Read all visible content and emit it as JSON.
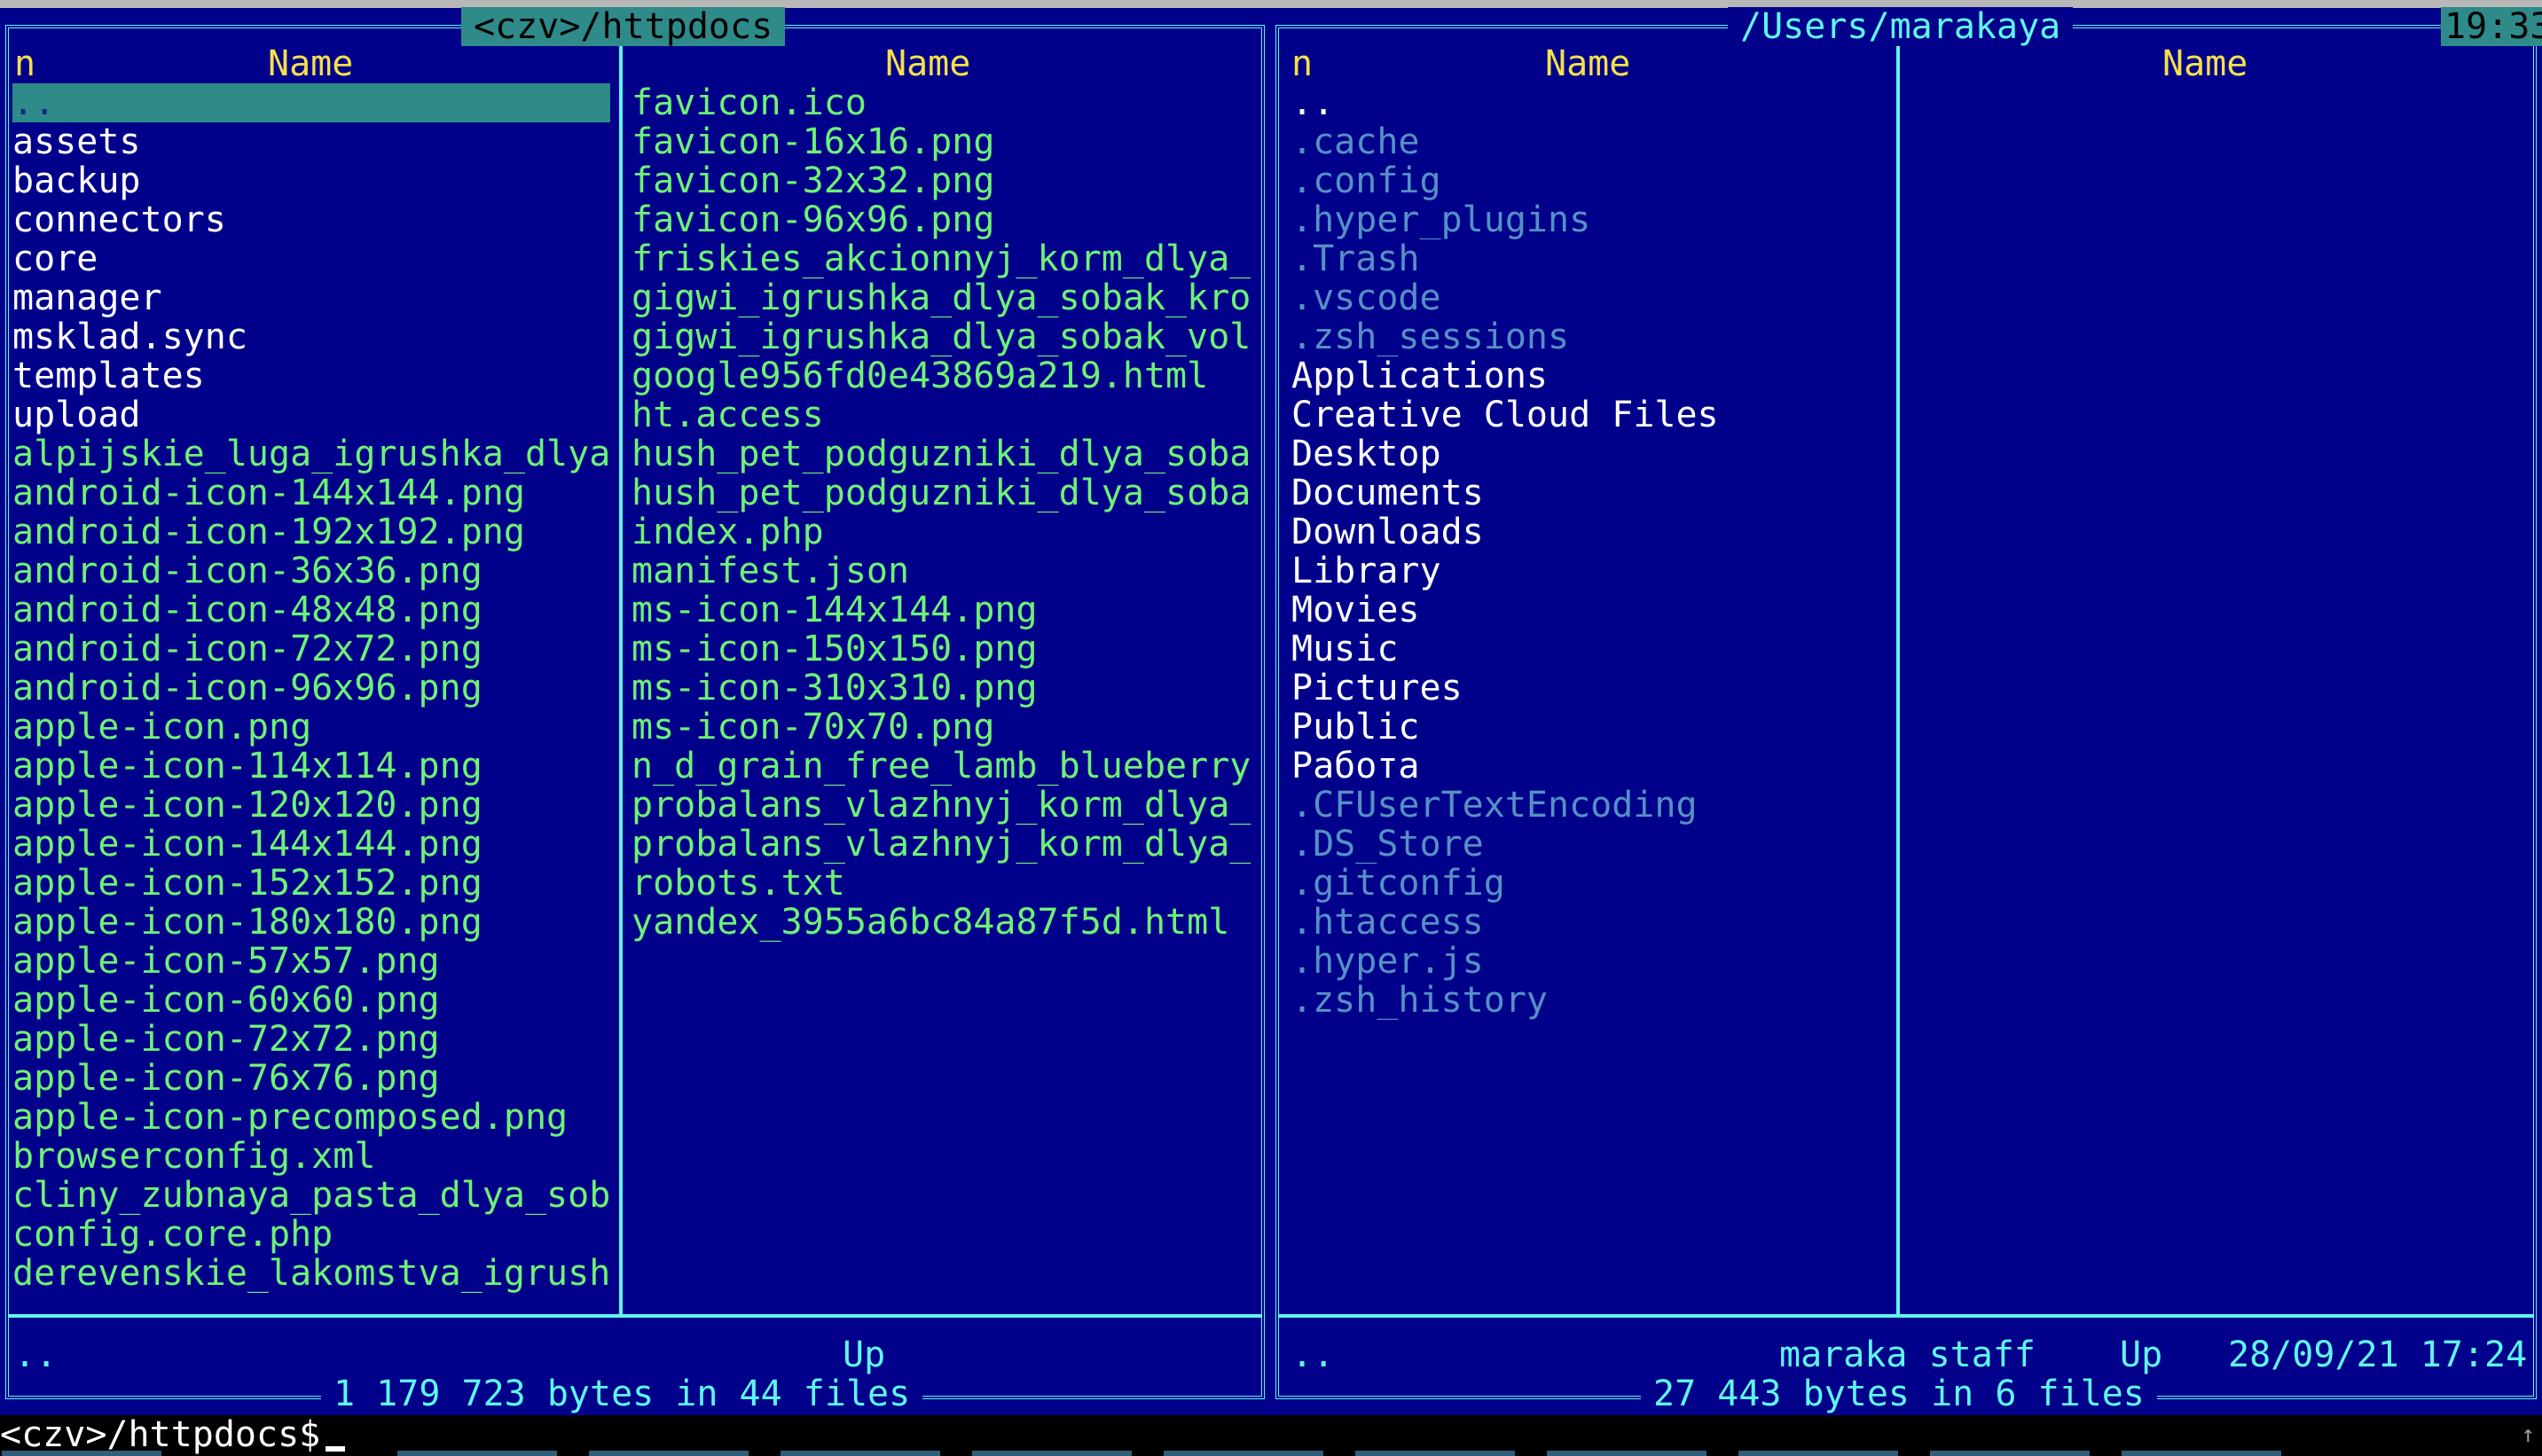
{
  "left_panel": {
    "title": "<czv>/httpdocs",
    "header_n": "n",
    "header_name_1": "Name",
    "header_name_2": "Name",
    "column1": [
      {
        "name": "..",
        "kind": "dir",
        "selected": true
      },
      {
        "name": "assets",
        "kind": "dir"
      },
      {
        "name": "backup",
        "kind": "dir"
      },
      {
        "name": "connectors",
        "kind": "dir"
      },
      {
        "name": "core",
        "kind": "dir"
      },
      {
        "name": "manager",
        "kind": "dir"
      },
      {
        "name": "msklad.sync",
        "kind": "dir"
      },
      {
        "name": "templates",
        "kind": "dir"
      },
      {
        "name": "upload",
        "kind": "dir"
      },
      {
        "name": "alpijskie_luga_igrushka_dlya",
        "kind": "file",
        "truncated": true
      },
      {
        "name": "android-icon-144x144.png",
        "kind": "file"
      },
      {
        "name": "android-icon-192x192.png",
        "kind": "file"
      },
      {
        "name": "android-icon-36x36.png",
        "kind": "file"
      },
      {
        "name": "android-icon-48x48.png",
        "kind": "file"
      },
      {
        "name": "android-icon-72x72.png",
        "kind": "file"
      },
      {
        "name": "android-icon-96x96.png",
        "kind": "file"
      },
      {
        "name": "apple-icon.png",
        "kind": "file"
      },
      {
        "name": "apple-icon-114x114.png",
        "kind": "file"
      },
      {
        "name": "apple-icon-120x120.png",
        "kind": "file"
      },
      {
        "name": "apple-icon-144x144.png",
        "kind": "file"
      },
      {
        "name": "apple-icon-152x152.png",
        "kind": "file"
      },
      {
        "name": "apple-icon-180x180.png",
        "kind": "file"
      },
      {
        "name": "apple-icon-57x57.png",
        "kind": "file"
      },
      {
        "name": "apple-icon-60x60.png",
        "kind": "file"
      },
      {
        "name": "apple-icon-72x72.png",
        "kind": "file"
      },
      {
        "name": "apple-icon-76x76.png",
        "kind": "file"
      },
      {
        "name": "apple-icon-precomposed.png",
        "kind": "file"
      },
      {
        "name": "browserconfig.xml",
        "kind": "file"
      },
      {
        "name": "cliny_zubnaya_pasta_dlya_sob",
        "kind": "file",
        "truncated": true
      },
      {
        "name": "config.core.php",
        "kind": "file"
      },
      {
        "name": "derevenskie_lakomstva_igrush",
        "kind": "file",
        "truncated": true
      }
    ],
    "column2": [
      {
        "name": "favicon.ico",
        "kind": "file"
      },
      {
        "name": "favicon-16x16.png",
        "kind": "file"
      },
      {
        "name": "favicon-32x32.png",
        "kind": "file"
      },
      {
        "name": "favicon-96x96.png",
        "kind": "file"
      },
      {
        "name": "friskies_akcionnyj_korm_dlya_",
        "kind": "file",
        "truncated": true
      },
      {
        "name": "gigwi_igrushka_dlya_sobak_kro",
        "kind": "file",
        "truncated": true
      },
      {
        "name": "gigwi_igrushka_dlya_sobak_vol",
        "kind": "file",
        "truncated": true
      },
      {
        "name": "google956fd0e43869a219.html",
        "kind": "file"
      },
      {
        "name": "ht.access",
        "kind": "file"
      },
      {
        "name": "hush_pet_podguzniki_dlya_soba",
        "kind": "file",
        "truncated": true
      },
      {
        "name": "hush_pet_podguzniki_dlya_soba",
        "kind": "file",
        "truncated": true
      },
      {
        "name": "index.php",
        "kind": "file"
      },
      {
        "name": "manifest.json",
        "kind": "file"
      },
      {
        "name": "ms-icon-144x144.png",
        "kind": "file"
      },
      {
        "name": "ms-icon-150x150.png",
        "kind": "file"
      },
      {
        "name": "ms-icon-310x310.png",
        "kind": "file"
      },
      {
        "name": "ms-icon-70x70.png",
        "kind": "file"
      },
      {
        "name": "n_d_grain_free_lamb_blueberry",
        "kind": "file",
        "truncated": true
      },
      {
        "name": "probalans_vlazhnyj_korm_dlya_",
        "kind": "file",
        "truncated": true
      },
      {
        "name": "probalans_vlazhnyj_korm_dlya_",
        "kind": "file",
        "truncated": true
      },
      {
        "name": "robots.txt",
        "kind": "file"
      },
      {
        "name": "yandex_3955a6bc84a87f5d.html",
        "kind": "file"
      }
    ],
    "info_left": "..",
    "info_right": "Up",
    "status": "1 179 723 bytes in 44 files"
  },
  "right_panel": {
    "title": "/Users/marakaya",
    "clock": "19:33",
    "header_n": "n",
    "header_name_1": "Name",
    "header_name_2": "Name",
    "column1": [
      {
        "name": "..",
        "kind": "parent"
      },
      {
        "name": ".cache",
        "kind": "hidden"
      },
      {
        "name": ".config",
        "kind": "hidden"
      },
      {
        "name": ".hyper_plugins",
        "kind": "hidden"
      },
      {
        "name": ".Trash",
        "kind": "hidden"
      },
      {
        "name": ".vscode",
        "kind": "hidden"
      },
      {
        "name": ".zsh_sessions",
        "kind": "hidden"
      },
      {
        "name": "Applications",
        "kind": "dir"
      },
      {
        "name": "Creative Cloud Files",
        "kind": "dir"
      },
      {
        "name": "Desktop",
        "kind": "dir"
      },
      {
        "name": "Documents",
        "kind": "dir"
      },
      {
        "name": "Downloads",
        "kind": "dir"
      },
      {
        "name": "Library",
        "kind": "dir"
      },
      {
        "name": "Movies",
        "kind": "dir"
      },
      {
        "name": "Music",
        "kind": "dir"
      },
      {
        "name": "Pictures",
        "kind": "dir"
      },
      {
        "name": "Public",
        "kind": "dir"
      },
      {
        "name": "Работа",
        "kind": "dir"
      },
      {
        "name": ".CFUserTextEncoding",
        "kind": "hidden"
      },
      {
        "name": ".DS_Store",
        "kind": "hidden"
      },
      {
        "name": ".gitconfig",
        "kind": "hidden"
      },
      {
        "name": ".htaccess",
        "kind": "hidden"
      },
      {
        "name": ".hyper.js",
        "kind": "hidden"
      },
      {
        "name": ".zsh_history",
        "kind": "hidden"
      }
    ],
    "column2": [],
    "info_left": "..",
    "info_owner": "maraka staff",
    "info_up": "Up",
    "info_date": "28/09/21 17:24",
    "status": "27 443 bytes in 6 files"
  },
  "command_line": {
    "prompt": "<czv>/httpdocs$"
  },
  "keybar_hint": "↑",
  "colors": {
    "panel_bg": "#00008b",
    "frame": "#5ff5f0",
    "header": "#f5e04a",
    "dir": "#ffffff",
    "file": "#6ef276",
    "hidden": "#5690c5",
    "selection": "#2f8a8a"
  }
}
